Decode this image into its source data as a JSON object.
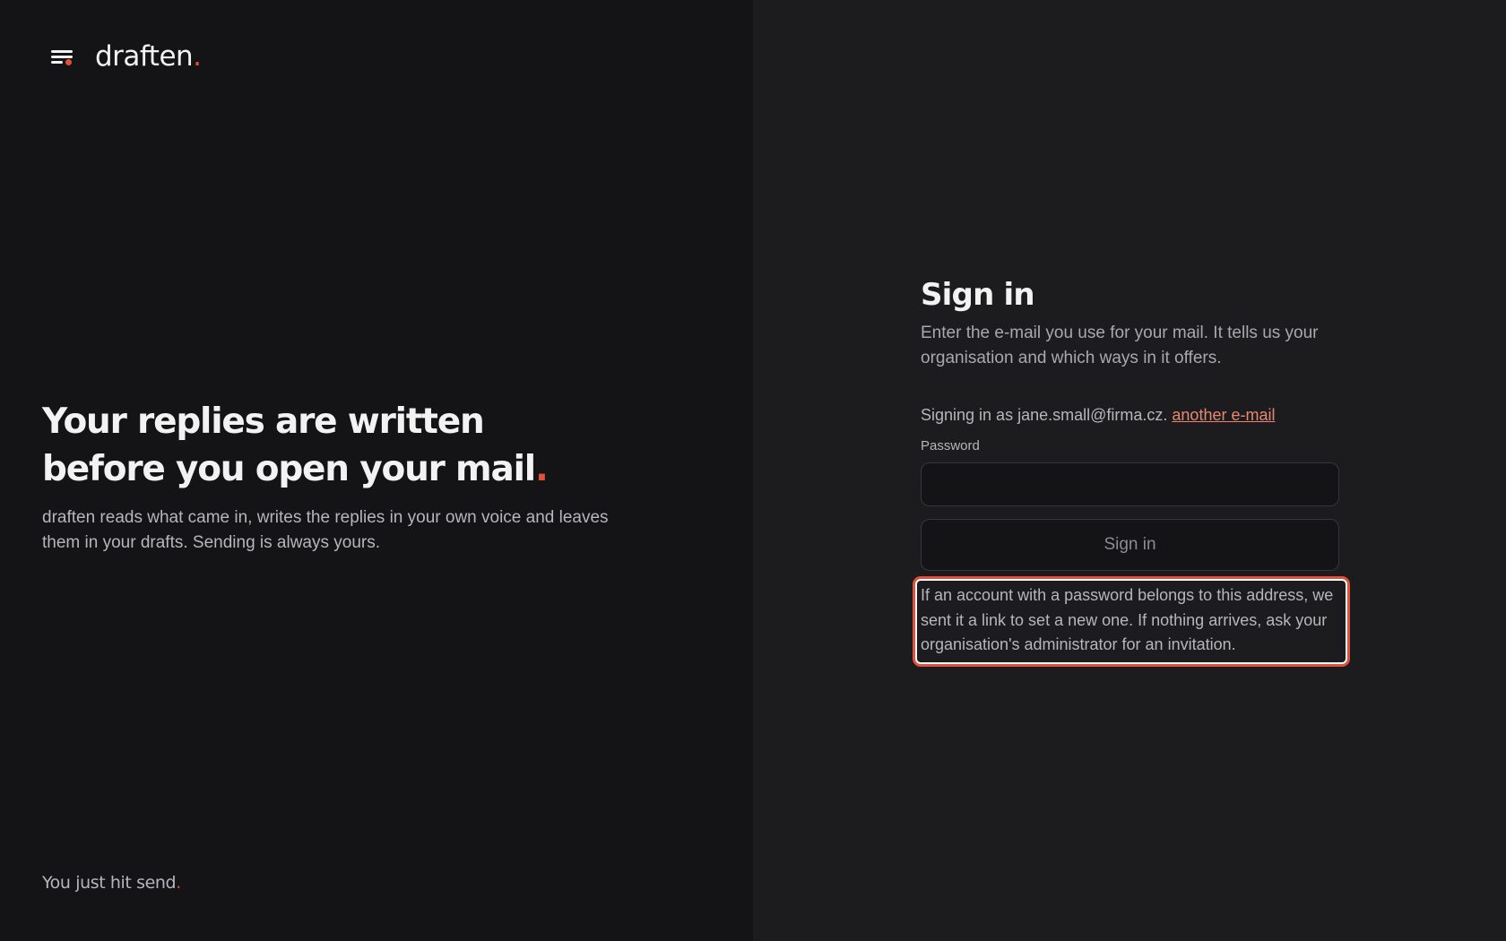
{
  "brand": {
    "name": "draften",
    "dot": ".",
    "accent_color": "#e0503a"
  },
  "hero": {
    "title_main": "Your replies are written before you open your mail",
    "title_dot": ".",
    "description": "draften reads what came in, writes the replies in your own voice and leaves them in your drafts. Sending is always yours."
  },
  "footer": {
    "tagline": "You just hit send",
    "dot": "."
  },
  "signin": {
    "title": "Sign in",
    "description": "Enter the e-mail you use for your mail. It tells us your organisation and which ways in it offers.",
    "signing_as_prefix": "Signing in as jane.small@firma.cz.",
    "change_email_link": "another e-mail",
    "password_label": "Password",
    "password_value": "",
    "button_label": "Sign in",
    "notice": "If an account with a password belongs to this address, we sent it a link to set a new one. If nothing arrives, ask your organisation's administrator for an invitation."
  }
}
